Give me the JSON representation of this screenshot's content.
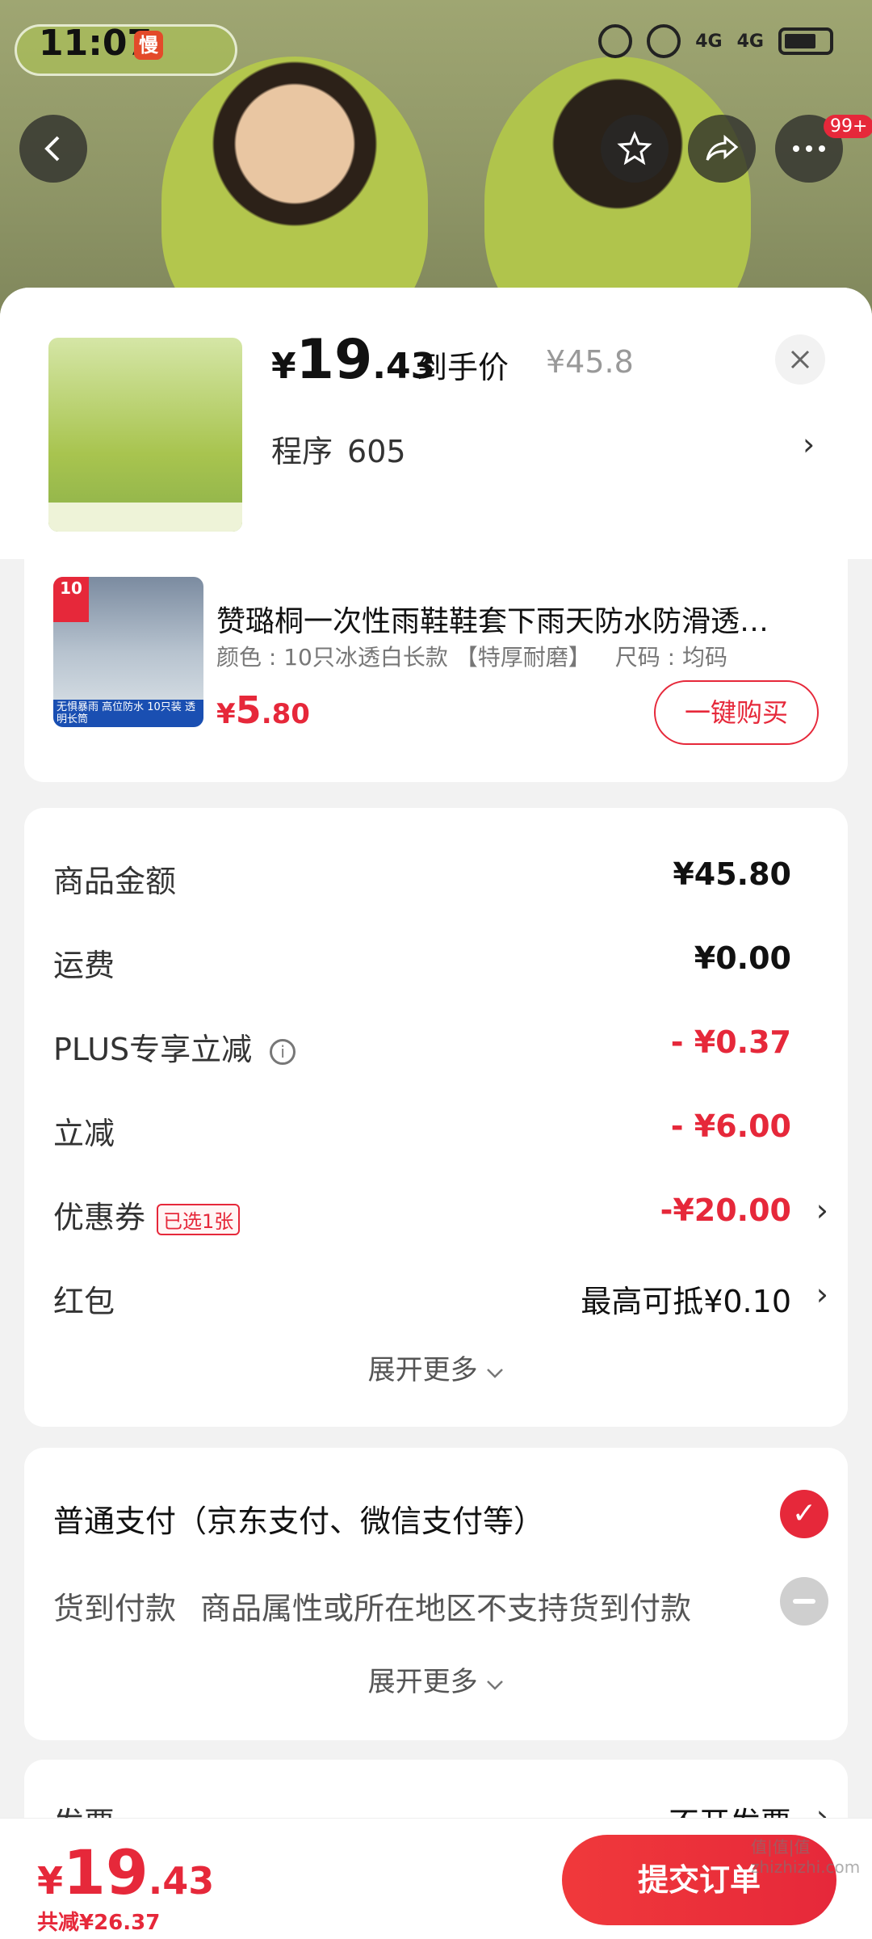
{
  "status_bar": {
    "time": "11:07",
    "app_badge": "慢",
    "signal1": "4G",
    "signal2": "4G"
  },
  "hero": {
    "more_badge": "99+"
  },
  "summary": {
    "currency": "¥",
    "price_int": "19",
    "price_dec": ".43",
    "deal_label": "到手价",
    "original_price": "¥45.8",
    "program_label": "程序",
    "program_value": "605"
  },
  "recommend": {
    "title": "赞璐桐一次性雨鞋鞋套下雨天防水防滑透…",
    "color_spec": "颜色 : 10只冰透白长款 【特厚耐磨】",
    "size_spec": "尺码 : 均码",
    "currency": "¥",
    "price_int": "5",
    "price_dec": ".80",
    "buy_label": "一键购买",
    "thumb_badge": "10",
    "thumb_strip": "无惧暴雨 高位防水 10只装 透明长筒"
  },
  "fees": [
    {
      "label": "商品金额",
      "value": "¥45.80"
    },
    {
      "label": "运费",
      "value": "¥0.00"
    },
    {
      "label": "PLUS专享立减",
      "value": "- ¥0.37"
    },
    {
      "label": "立减",
      "value": "- ¥6.00"
    },
    {
      "label": "优惠券",
      "tag": "已选1张",
      "value": "-¥20.00"
    },
    {
      "label": "红包",
      "value": "最高可抵¥0.10"
    }
  ],
  "fees_expand": "展开更多",
  "payment": {
    "option1": "普通支付（京东支付、微信支付等）",
    "option2_label": "货到付款",
    "option2_note": "商品属性或所在地区不支持货到付款",
    "expand": "展开更多"
  },
  "invoice": {
    "label": "发票",
    "value": "不开发票"
  },
  "bottom": {
    "currency": "¥",
    "total_int": "19",
    "total_dec": ".43",
    "saved": "共减¥26.37",
    "submit": "提交订单",
    "watermark": "值|值|值 zhizhizhi.com"
  },
  "colors": {
    "accent": "#e6283a"
  }
}
